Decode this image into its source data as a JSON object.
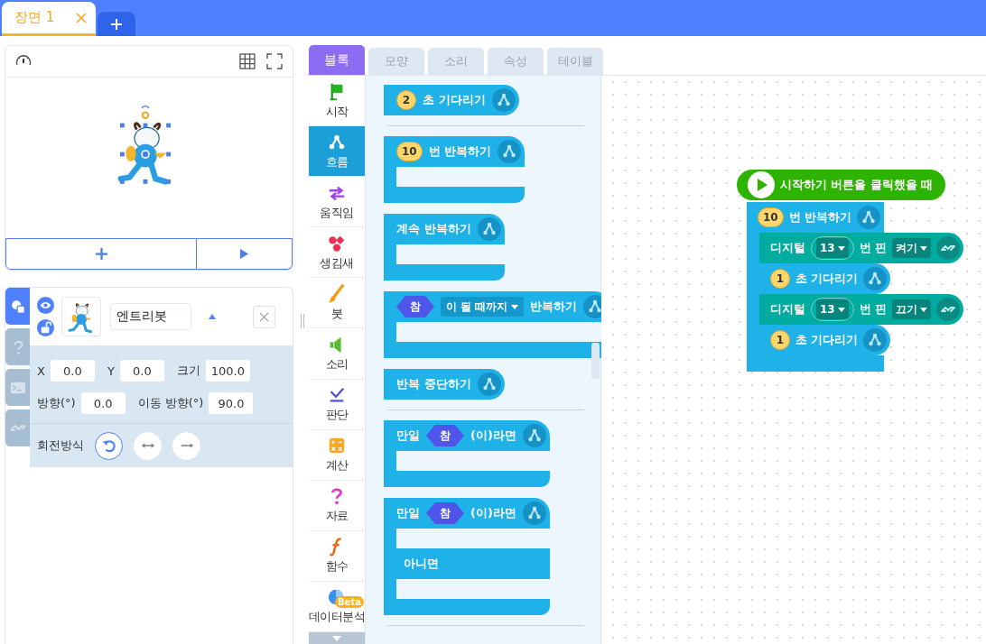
{
  "scene_tabs": [
    {
      "label": "장면 1",
      "selected": true
    }
  ],
  "object": {
    "name": "엔트리봇",
    "visible": true,
    "locked": false
  },
  "side_tabs": [
    {
      "kind": "objects",
      "selected": true
    },
    {
      "kind": "help",
      "selected": false
    },
    {
      "kind": "console",
      "selected": false
    },
    {
      "kind": "hardware",
      "selected": false
    }
  ],
  "property_rows": [
    [
      {
        "label": "X",
        "value": "0.0"
      },
      {
        "label": "Y",
        "value": "0.0"
      },
      {
        "label": "크기",
        "value": "100.0"
      }
    ],
    [
      {
        "label": "방향(°)",
        "value": "0.0"
      },
      {
        "label": "이동 방향(°)",
        "value": "90.0"
      }
    ]
  ],
  "rotation": {
    "label": "회전방식",
    "modes": [
      {
        "kind": "free",
        "selected": true
      },
      {
        "kind": "horizontal",
        "selected": false
      },
      {
        "kind": "none",
        "selected": false
      }
    ]
  },
  "editor_tabs": [
    {
      "label": "블록",
      "selected": true
    },
    {
      "label": "모양",
      "selected": false
    },
    {
      "label": "소리",
      "selected": false
    },
    {
      "label": "속성",
      "selected": false
    },
    {
      "label": "테이블",
      "selected": false
    }
  ],
  "categories": [
    {
      "kind": "start",
      "label": "시작",
      "selected": false
    },
    {
      "kind": "flow",
      "label": "흐름",
      "selected": true
    },
    {
      "kind": "motion",
      "label": "움직임",
      "selected": false
    },
    {
      "kind": "looks",
      "label": "생김새",
      "selected": false
    },
    {
      "kind": "brush",
      "label": "붓",
      "selected": false
    },
    {
      "kind": "sound",
      "label": "소리",
      "selected": false
    },
    {
      "kind": "judge",
      "label": "판단",
      "selected": false
    },
    {
      "kind": "calc",
      "label": "계산",
      "selected": false
    },
    {
      "kind": "data",
      "label": "자료",
      "selected": false
    },
    {
      "kind": "function",
      "label": "함수",
      "selected": false
    },
    {
      "kind": "analysis",
      "label": "데이터분석",
      "badge": "Beta",
      "selected": false
    }
  ],
  "palette": [
    [
      {
        "kind": "command",
        "parts": [
          {
            "kind": "number",
            "text": "2"
          },
          {
            "kind": "text",
            "text": "초 기다리기"
          }
        ]
      }
    ],
    [
      {
        "kind": "loop",
        "parts": [
          {
            "kind": "number",
            "text": "10"
          },
          {
            "kind": "text",
            "text": "번 반복하기"
          }
        ]
      },
      {
        "kind": "loop",
        "parts": [
          {
            "kind": "text",
            "text": "계속 반복하기"
          }
        ]
      },
      {
        "kind": "loop",
        "parts": [
          {
            "kind": "boolean",
            "text": "참"
          },
          {
            "kind": "dropdown",
            "text": "이 될 때까지"
          },
          {
            "kind": "text",
            "text": "반복하기"
          }
        ]
      },
      {
        "kind": "command",
        "parts": [
          {
            "kind": "text",
            "text": "반복 중단하기"
          }
        ]
      }
    ],
    [
      {
        "kind": "loop",
        "parts": [
          {
            "kind": "text",
            "text": "만일"
          },
          {
            "kind": "boolean",
            "text": "참"
          },
          {
            "kind": "text",
            "text": "(이)라면"
          }
        ]
      },
      {
        "kind": "ifelse",
        "parts": [
          {
            "kind": "text",
            "text": "만일"
          },
          {
            "kind": "boolean",
            "text": "참"
          },
          {
            "kind": "text",
            "text": "(이)라면"
          }
        ],
        "else_label": "아니면"
      }
    ]
  ],
  "script": [
    {
      "kind": "hat",
      "parts": [
        {
          "kind": "text",
          "text": "시작하기 버튼을 클릭했을 때"
        }
      ]
    },
    {
      "kind": "loop",
      "parts": [
        {
          "kind": "number",
          "text": "10"
        },
        {
          "kind": "text",
          "text": "번 반복하기"
        }
      ],
      "children": [
        {
          "kind": "hardware",
          "parts": [
            {
              "kind": "text",
              "text": "디지털"
            },
            {
              "kind": "pin",
              "text": "13"
            },
            {
              "kind": "text",
              "text": "번 핀"
            },
            {
              "kind": "dropdown",
              "text": "켜기"
            }
          ]
        },
        {
          "kind": "command",
          "parts": [
            {
              "kind": "number",
              "text": "1"
            },
            {
              "kind": "text",
              "text": "초 기다리기"
            }
          ]
        },
        {
          "kind": "hardware",
          "parts": [
            {
              "kind": "text",
              "text": "디지털"
            },
            {
              "kind": "pin",
              "text": "13"
            },
            {
              "kind": "text",
              "text": "번 핀"
            },
            {
              "kind": "dropdown",
              "text": "끄기"
            }
          ]
        },
        {
          "kind": "command",
          "parts": [
            {
              "kind": "number",
              "text": "1"
            },
            {
              "kind": "text",
              "text": "초 기다리기"
            }
          ]
        }
      ]
    }
  ]
}
